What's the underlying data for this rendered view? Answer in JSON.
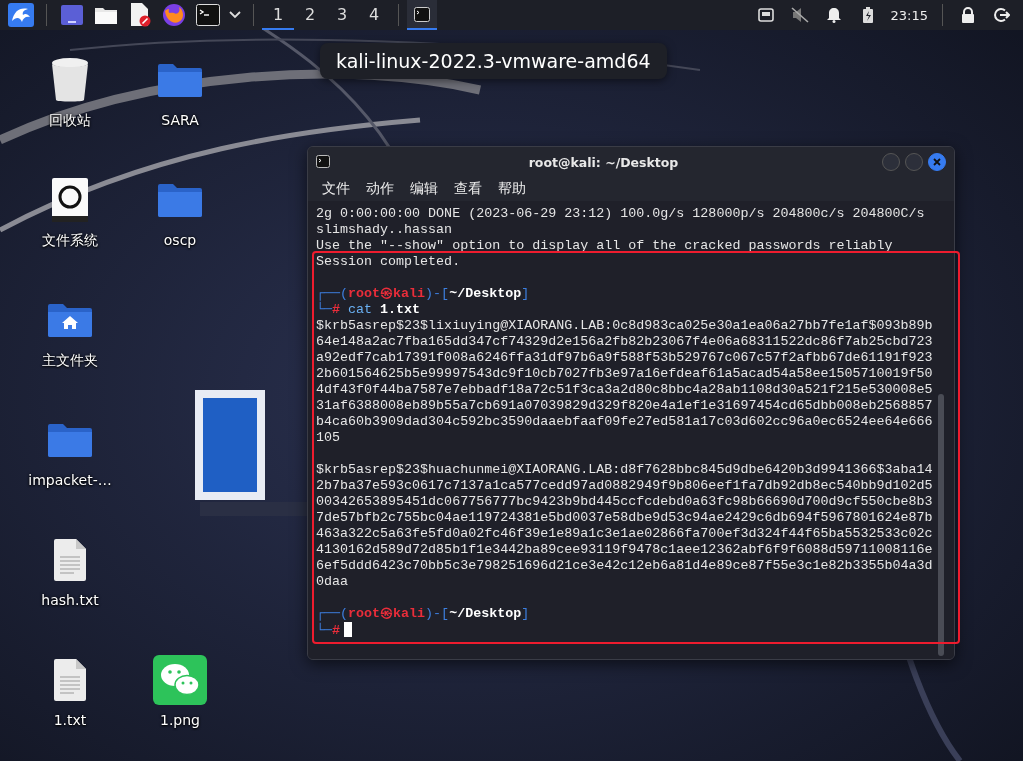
{
  "taskbar": {
    "launchers": [
      {
        "kind": "menu"
      },
      {
        "kind": "app"
      },
      {
        "kind": "folder"
      },
      {
        "kind": "editor"
      },
      {
        "kind": "browser"
      },
      {
        "kind": "terminal"
      },
      {
        "kind": "more"
      }
    ],
    "workspaces": [
      {
        "label": "1",
        "selected": true
      },
      {
        "label": "2",
        "selected": false
      },
      {
        "label": "3",
        "selected": false
      },
      {
        "label": "4",
        "selected": false
      }
    ],
    "tasks": [
      {
        "kind": "terminal",
        "selected": true
      }
    ],
    "tray": {
      "muted": true,
      "clock": "23:15"
    }
  },
  "tooltip": "kali-linux-2022.3-vmware-amd64",
  "desktop_icons": [
    {
      "kind": "trash",
      "label": "回收站"
    },
    {
      "kind": "folder",
      "label": "SARA"
    },
    {
      "kind": "drive",
      "label": "文件系统"
    },
    {
      "kind": "folder",
      "label": "oscp"
    },
    {
      "kind": "home",
      "label": "主文件夹"
    },
    {
      "kind": "folder",
      "label": "impacket-…"
    },
    {
      "kind": "document",
      "label": "hash.txt"
    },
    {
      "kind": "document",
      "label": "1.txt"
    },
    {
      "kind": "chat",
      "label": "1.png"
    }
  ],
  "terminal": {
    "title": "root@kali: ~/Desktop",
    "menu": [
      "文件",
      "动作",
      "编辑",
      "查看",
      "帮助"
    ],
    "lines": [
      {
        "kind": "output",
        "text": "2g 0:00:00:00 DONE (2023-06-29 23:12) 100.0g/s 128000p/s 204800c/s 204800C/s"
      },
      {
        "kind": "output",
        "text": "slimshady..hassan"
      },
      {
        "kind": "output",
        "text": "Use the \"--show\" option to display all of the cracked passwords reliably"
      },
      {
        "kind": "output",
        "text": "Session completed."
      },
      {
        "kind": "blank"
      },
      {
        "kind": "prompt",
        "corner": "┌──(",
        "user": "root㉿kali",
        "sep": ")-[",
        "path": "~/Desktop",
        "end": "]"
      },
      {
        "kind": "command",
        "corner": "└─",
        "symbol": "#",
        "program": "cat",
        "args": "1.txt",
        "cursor": false
      },
      {
        "kind": "output",
        "text": "$krb5asrep$23$lixiuying@XIAORANG.LAB:0c8d983ca025e30a1ea06a27bb7fe1af$093b89b"
      },
      {
        "kind": "output",
        "text": "64e148a2ac7fba165dd347cf74329d2e156a2fb82b23067f4e06a68311522dc86f7ab25cbd723"
      },
      {
        "kind": "output",
        "text": "a92edf7cab17391f008a6246ffa31df97b6a9f588f53b529767c067c57f2afbb67de61191f923"
      },
      {
        "kind": "output",
        "text": "2b601564625b5e99997543dc9f10cb7027fb3e97a16efdeaf61a5acad54a58ee1505710019f50"
      },
      {
        "kind": "output",
        "text": "4df43f0f44ba7587e7ebbadf18a72c51f3ca3a2d80c8bbc4a28ab1108d30a521f215e530008e5"
      },
      {
        "kind": "output",
        "text": "31af6388008eb89b55a7cb691a07039829d329f820e4a1ef1e31697454cd65dbb008eb2568857"
      },
      {
        "kind": "output",
        "text": "b4ca60b3909dad304c592bc3590daaebfaaf09fe27ed581a17c03d602cc96a0ec6524ee64e666"
      },
      {
        "kind": "output",
        "text": "105"
      },
      {
        "kind": "blank"
      },
      {
        "kind": "output",
        "text": "$krb5asrep$23$huachunmei@XIAORANG.LAB:d8f7628bbc845d9dbe6420b3d9941366$3aba14"
      },
      {
        "kind": "output",
        "text": "2b7ba37e593c0617c7137a1ca577cedd97ad0882949f9b806eef1fa7db92db8ec540bb9d102d5"
      },
      {
        "kind": "output",
        "text": "00342653895451dc067756777bc9423b9bd445ccfcdebd0a63fc98b66690d700d9cf550cbe8b3"
      },
      {
        "kind": "output",
        "text": "7de57bfb2c755bc04ae119724381e5bd0037e58dbe9d53c94ae2429c6db694f5967801624e87b"
      },
      {
        "kind": "output",
        "text": "463a322c5a63fe5fd0a02fc46f39e1e89a1c3e1ae02866fa700ef3d324f44f65ba5532533c02c"
      },
      {
        "kind": "output",
        "text": "4130162d589d72d85b1f1e3442ba89cee93119f9478c1aee12362abf6f9f6088d59711008116e"
      },
      {
        "kind": "output",
        "text": "6ef5ddd6423c70bb5c3e798251696d21ce3e42c12eb6a81d4e89ce87f55e3c1e82b3355b04a3d"
      },
      {
        "kind": "output",
        "text": "0daa"
      },
      {
        "kind": "blank"
      },
      {
        "kind": "prompt",
        "corner": "┌──(",
        "user": "root㉿kali",
        "sep": ")-[",
        "path": "~/Desktop",
        "end": "]"
      },
      {
        "kind": "command",
        "corner": "└─",
        "symbol": "#",
        "cursor": true
      }
    ]
  }
}
